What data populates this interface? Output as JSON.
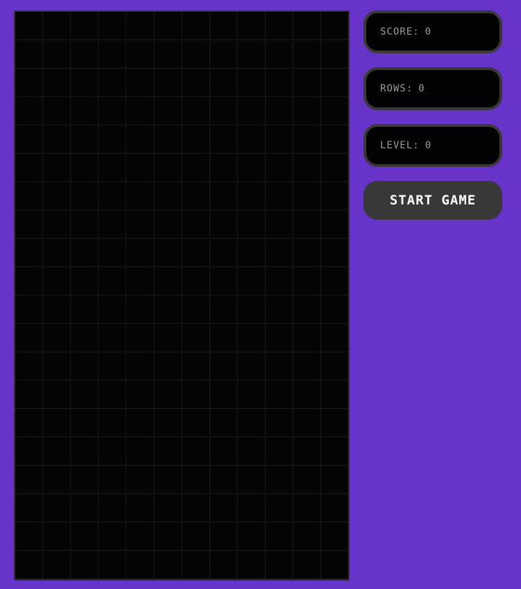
{
  "stats": {
    "score_label": "SCORE",
    "score_value": "0",
    "rows_label": "ROWS",
    "rows_value": "0",
    "level_label": "LEVEL",
    "level_value": "0",
    "separator": ":"
  },
  "controls": {
    "start_label": "START GAME"
  },
  "board": {
    "columns": 12,
    "rows": 20
  },
  "colors": {
    "page_background": "#6833c9",
    "board_background": "#040404",
    "panel_border": "#3a3a3a",
    "button_background": "#383838"
  }
}
